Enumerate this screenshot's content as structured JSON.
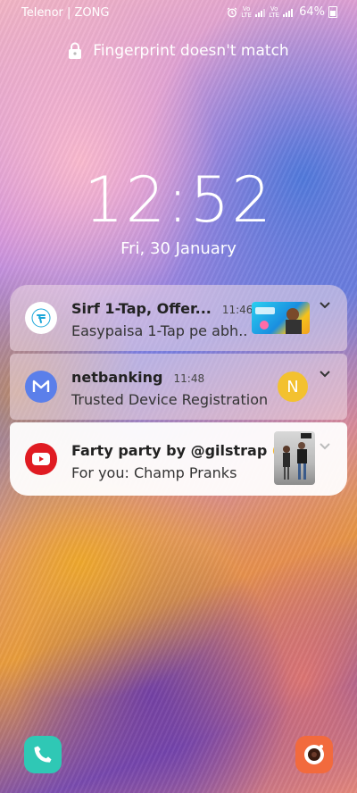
{
  "status_bar": {
    "carrier": "Telenor | ZONG",
    "sim1_label": "VoLTE",
    "sim2_label": "VoLTE",
    "battery": "64%"
  },
  "lock": {
    "message": "Fingerprint doesn't match"
  },
  "clock": {
    "time": "12:52",
    "date": "Fri, 30 January"
  },
  "notifications": [
    {
      "app": "easypaisa",
      "title": "Sirf 1-Tap, Offer...",
      "time": "11:46",
      "text": "Easypaisa 1-Tap pe abh..",
      "icon": "easypaisa-icon"
    },
    {
      "app": "netbanking",
      "title": "netbanking",
      "time": "11:48",
      "text": "Trusted Device Registration",
      "avatar_letter": "N",
      "icon": "netbanking-icon"
    },
    {
      "app": "youtube",
      "title": "Farty party by @gilstrap 🤣...",
      "time": "",
      "text": "For you: Champ Pranks",
      "icon": "youtube-icon"
    }
  ],
  "shortcuts": {
    "left": "phone-icon",
    "right": "camera-icon"
  },
  "colors": {
    "phone": "#2fc8b5",
    "camera": "#f26a3d",
    "youtube": "#e01b22",
    "netbanking": "#5b7fea",
    "avatar": "#f3c12f"
  }
}
